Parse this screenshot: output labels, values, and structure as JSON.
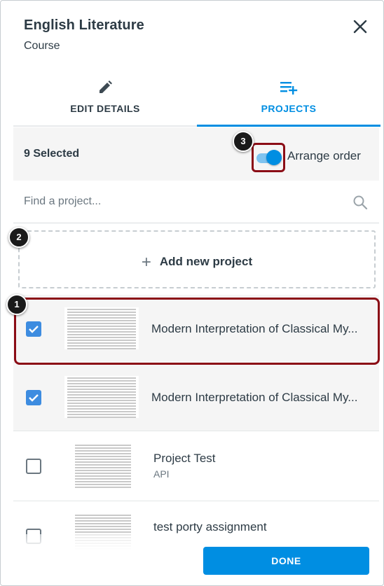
{
  "header": {
    "title": "English Literature",
    "subtitle": "Course",
    "close_icon": "close-icon"
  },
  "tabs": [
    {
      "label": "EDIT DETAILS",
      "icon": "pencil-icon",
      "active": false
    },
    {
      "label": "PROJECTS",
      "icon": "playlist-add-icon",
      "active": true
    }
  ],
  "selection": {
    "count_label": "9 Selected",
    "arrange_label": "Arrange order",
    "arrange_on": true
  },
  "search": {
    "placeholder": "Find a project...",
    "icon": "search-icon"
  },
  "add_project": {
    "label": "Add new project",
    "icon": "plus-icon"
  },
  "projects": [
    {
      "title": "Modern Interpretation of Classical My...",
      "subtitle": "",
      "checked": true
    },
    {
      "title": "Modern Interpretation of Classical My...",
      "subtitle": "",
      "checked": true
    },
    {
      "title": "Project Test",
      "subtitle": "API",
      "checked": false
    },
    {
      "title": "test porty assignment",
      "subtitle": "",
      "checked": false
    }
  ],
  "callouts": [
    "1",
    "2",
    "3"
  ],
  "footer": {
    "done_label": "DONE"
  },
  "colors": {
    "accent": "#008ee2",
    "checkbox": "#3d8ce0",
    "highlight": "#8b0d16",
    "text": "#2d3b45"
  }
}
